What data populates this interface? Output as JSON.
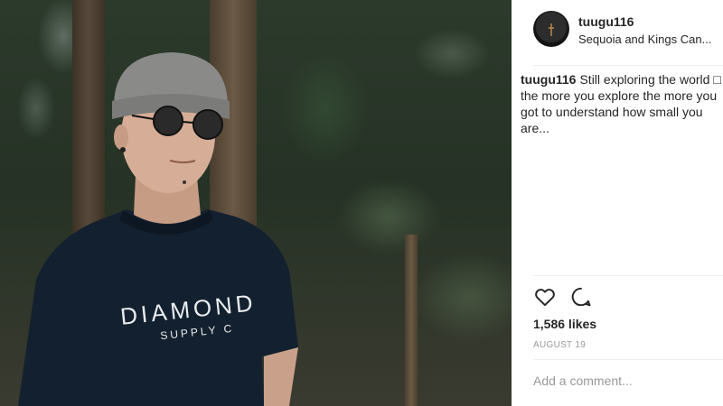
{
  "post": {
    "username": "tuugu116",
    "location": "Sequoia and Kings Can...",
    "caption_user": "tuugu116",
    "caption_text": "Still exploring the world □ the more you explore the more you got to understand how small you are...",
    "likes": "1,586 likes",
    "date": "AUGUST 19",
    "comment_placeholder": "Add a comment..."
  },
  "photo": {
    "shirt_brand": "DIAMOND",
    "shirt_sub": "SUPPLY C"
  },
  "icons": {
    "like": "heart-icon",
    "comment": "comment-icon"
  },
  "colors": {
    "text": "#262626",
    "muted": "#999999",
    "divider": "#efefef"
  }
}
